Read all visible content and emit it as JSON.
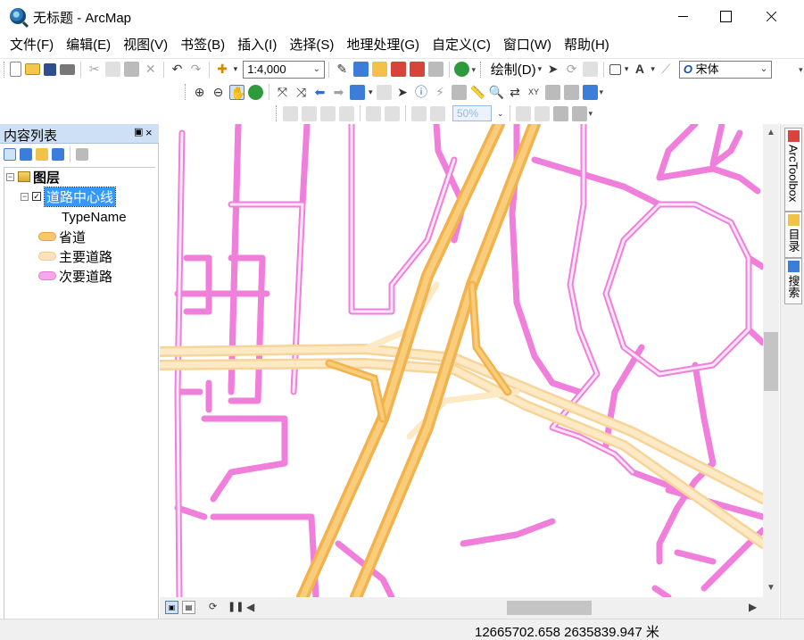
{
  "window": {
    "title": "无标题 - ArcMap",
    "min_icon": "minimize-icon",
    "max_icon": "maximize-icon",
    "close_icon": "close-icon"
  },
  "menu": [
    "文件(F)",
    "编辑(E)",
    "视图(V)",
    "书签(B)",
    "插入(I)",
    "选择(S)",
    "地理处理(G)",
    "自定义(C)",
    "窗口(W)",
    "帮助(H)"
  ],
  "toolbar": {
    "scale_value": "1:4,000",
    "drawing_label": "绘制(D)",
    "font_value": "宋体",
    "font_icon": "O",
    "zoom_value": "50%",
    "text_tool": "A"
  },
  "toc": {
    "title": "内容列表",
    "pin": "📌",
    "close": "×",
    "layers_label": "图层",
    "layer_name": "道路中心线",
    "field_name": "TypeName",
    "legend": [
      {
        "label": "省道",
        "fill": "#f5c96a",
        "stroke": "#e0a43a"
      },
      {
        "label": "主要道路",
        "fill": "#fde3b6",
        "stroke": "#f3c98b"
      },
      {
        "label": "次要道路",
        "fill": "#f7a8ec",
        "stroke": "#ec7ad8"
      }
    ]
  },
  "dock": {
    "arctoolbox": "ArcToolbox",
    "catalog": "目录",
    "search": "搜索"
  },
  "status": {
    "coordinates": "12665702.658  2635839.947 米"
  },
  "colors": {
    "provincial_road": "#f5bd5e",
    "main_road": "#fde3b6",
    "minor_road": "#f7a2e8",
    "toc_header": "#cde0f5",
    "selection": "#3399ff"
  }
}
